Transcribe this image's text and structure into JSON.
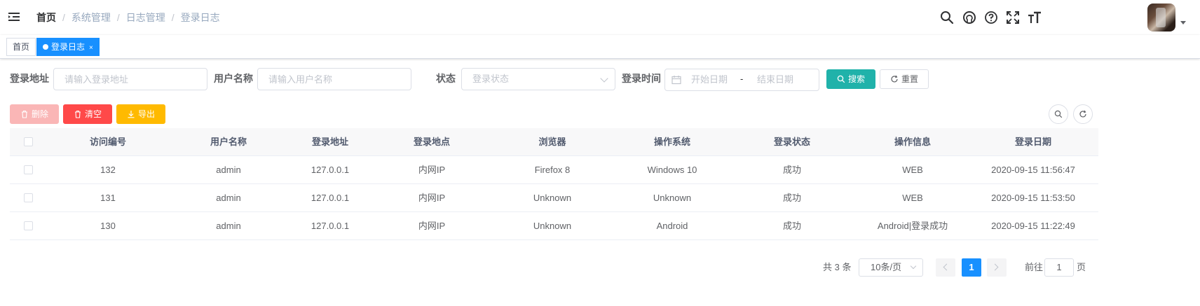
{
  "breadcrumb": [
    "首页",
    "系统管理",
    "日志管理",
    "登录日志"
  ],
  "breadcrumb_separator": "/",
  "right_menu_icons": [
    "search-icon",
    "github-icon",
    "question-icon",
    "fullscreen-icon",
    "font-size-icon"
  ],
  "tags": [
    {
      "label": "首页",
      "active": false
    },
    {
      "label": "登录日志",
      "active": true,
      "close": "×"
    }
  ],
  "search": {
    "ipaddr_label": "登录地址",
    "ipaddr_placeholder": "请输入登录地址",
    "username_label": "用户名称",
    "username_placeholder": "请输入用户名称",
    "status_label": "状态",
    "status_placeholder": "登录状态",
    "time_label": "登录时间",
    "start_placeholder": "开始日期",
    "range_sep": "-",
    "end_placeholder": "结束日期",
    "search_btn": "搜索",
    "reset_btn": "重置"
  },
  "toolbar": {
    "delete_btn": "删除",
    "clean_btn": "清空",
    "export_btn": "导出"
  },
  "colors": {
    "primary": "#20b2aa",
    "active_tag": "#1890ff",
    "danger": "#ff4949",
    "warning": "#ffba00"
  },
  "table": {
    "columns": [
      "访问编号",
      "用户名称",
      "登录地址",
      "登录地点",
      "浏览器",
      "操作系统",
      "登录状态",
      "操作信息",
      "登录日期"
    ],
    "rows": [
      [
        "132",
        "admin",
        "127.0.0.1",
        "内网IP",
        "Firefox 8",
        "Windows 10",
        "成功",
        "WEB",
        "2020-09-15 11:56:47"
      ],
      [
        "131",
        "admin",
        "127.0.0.1",
        "内网IP",
        "Unknown",
        "Unknown",
        "成功",
        "WEB",
        "2020-09-15 11:53:50"
      ],
      [
        "130",
        "admin",
        "127.0.0.1",
        "内网IP",
        "Unknown",
        "Android",
        "成功",
        "Android|登录成功",
        "2020-09-15 11:22:49"
      ]
    ]
  },
  "pagination": {
    "total_text": "共 3 条",
    "page_size": "10条/页",
    "current_page": "1",
    "goto_prefix": "前往",
    "goto_value": "1",
    "goto_suffix": "页"
  }
}
